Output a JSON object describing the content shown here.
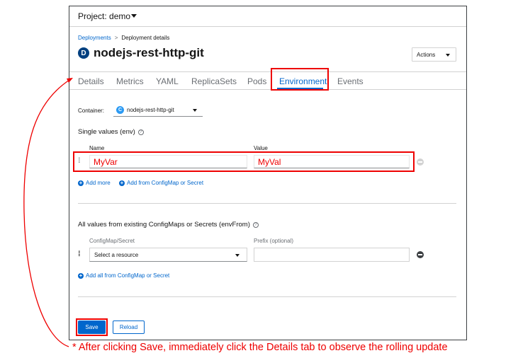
{
  "project": {
    "label": "Project: demo"
  },
  "breadcrumb": {
    "parent": "Deployments",
    "separator": ">",
    "current": "Deployment details"
  },
  "deployment": {
    "badge": "D",
    "name": "nodejs-rest-http-git"
  },
  "actions_label": "Actions",
  "tabs": [
    {
      "label": "Details"
    },
    {
      "label": "Metrics"
    },
    {
      "label": "YAML"
    },
    {
      "label": "ReplicaSets"
    },
    {
      "label": "Pods"
    },
    {
      "label": "Environment"
    },
    {
      "label": "Events"
    }
  ],
  "container": {
    "label": "Container:",
    "badge": "C",
    "value": "nodejs-rest-http-git"
  },
  "env": {
    "title": "Single values (env)",
    "name_col": "Name",
    "value_col": "Value",
    "name_value": "MyVar",
    "value_value": "MyVal",
    "add_more": "Add more",
    "add_from": "Add from ConfigMap or Secret"
  },
  "envfrom": {
    "title": "All values from existing ConfigMaps or Secrets (envFrom)",
    "resource_col": "ConfigMap/Secret",
    "prefix_col": "Prefix (optional)",
    "select_placeholder": "Select a resource",
    "add_all": "Add all from ConfigMap or Secret"
  },
  "buttons": {
    "save": "Save",
    "reload": "Reload"
  },
  "annotation": "* After clicking Save, immediately click the Details tab to observe the rolling update",
  "colors": {
    "highlight": "#e00000",
    "accent": "#0066cc"
  }
}
